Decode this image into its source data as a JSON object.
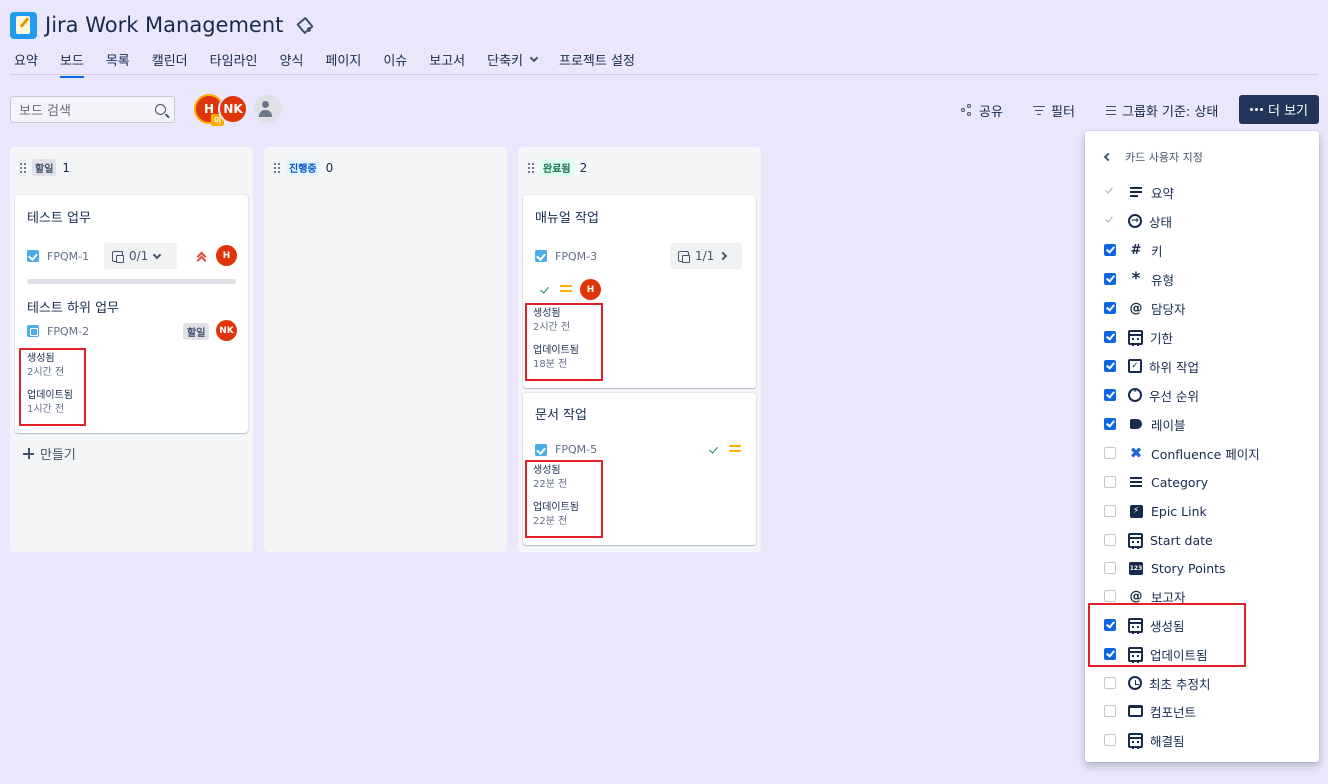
{
  "header": {
    "title": "Jira Work Management"
  },
  "tabs": [
    {
      "label": "요약"
    },
    {
      "label": "보드"
    },
    {
      "label": "목록"
    },
    {
      "label": "캘린더"
    },
    {
      "label": "타임라인"
    },
    {
      "label": "양식"
    },
    {
      "label": "페이지"
    },
    {
      "label": "이슈"
    },
    {
      "label": "보고서"
    },
    {
      "label": "단축키"
    },
    {
      "label": "프로젝트 설정"
    }
  ],
  "toolbar": {
    "search_placeholder": "보드 검색",
    "avatar_h": "H",
    "avatar_h_badge": "이",
    "avatar_nk": "NK",
    "share": "공유",
    "filter": "필터",
    "group_by": "그룹화 기준: 상태",
    "more": "더 보기"
  },
  "columns": [
    {
      "status": "할일",
      "count": "1"
    },
    {
      "status": "진행중",
      "count": "0"
    },
    {
      "status": "완료됨",
      "count": "2"
    }
  ],
  "cards": {
    "c1": {
      "title": "테스트 업무",
      "key": "FPQM-1",
      "child_progress": "0/1",
      "assignee": "H",
      "subtask_title": "테스트 하위 업무",
      "subtask_key": "FPQM-2",
      "subtask_status": "할일",
      "subtask_assignee": "NK",
      "created_label": "생성됨",
      "created_value": "2시간 전",
      "updated_label": "업데이트됨",
      "updated_value": "1시간 전"
    },
    "c3": {
      "title": "매뉴얼 작업",
      "key": "FPQM-3",
      "child_progress": "1/1",
      "assignee": "H",
      "created_label": "생성됨",
      "created_value": "2시간 전",
      "updated_label": "업데이트됨",
      "updated_value": "18분 전"
    },
    "c5": {
      "title": "문서 작업",
      "key": "FPQM-5",
      "created_label": "생성됨",
      "created_value": "22분 전",
      "updated_label": "업데이트됨",
      "updated_value": "22분 전"
    },
    "create_label": "만들기"
  },
  "panel": {
    "title": "카드 사용자 지정",
    "options": [
      {
        "label": "요약",
        "state": "disabled",
        "icon": "summary-lines-icon"
      },
      {
        "label": "상태",
        "state": "disabled",
        "icon": "status-arrow-icon"
      },
      {
        "label": "키",
        "state": "checked",
        "icon": "hash-icon"
      },
      {
        "label": "유형",
        "state": "checked",
        "icon": "asterisk-icon"
      },
      {
        "label": "담당자",
        "state": "checked",
        "icon": "at-icon"
      },
      {
        "label": "기한",
        "state": "checked",
        "icon": "calendar-icon"
      },
      {
        "label": "하위 작업",
        "state": "checked",
        "icon": "subtask-icon"
      },
      {
        "label": "우선 순위",
        "state": "checked",
        "icon": "priority-icon"
      },
      {
        "label": "레이블",
        "state": "checked",
        "icon": "tag-icon"
      },
      {
        "label": "Confluence 페이지",
        "state": "unchecked",
        "icon": "confluence-icon"
      },
      {
        "label": "Category",
        "state": "unchecked",
        "icon": "list-icon"
      },
      {
        "label": "Epic Link",
        "state": "unchecked",
        "icon": "epic-bolt-icon"
      },
      {
        "label": "Start date",
        "state": "unchecked",
        "icon": "calendar-icon"
      },
      {
        "label": "Story Points",
        "state": "unchecked",
        "icon": "story-points-icon"
      },
      {
        "label": "보고자",
        "state": "unchecked",
        "icon": "at-icon"
      },
      {
        "label": "생성됨",
        "state": "checked",
        "icon": "calendar-icon"
      },
      {
        "label": "업데이트됨",
        "state": "checked",
        "icon": "calendar-icon"
      },
      {
        "label": "최초 추정치",
        "state": "unchecked",
        "icon": "clock-icon"
      },
      {
        "label": "컴포넌트",
        "state": "unchecked",
        "icon": "component-icon"
      },
      {
        "label": "해결됨",
        "state": "unchecked",
        "icon": "calendar-icon"
      }
    ]
  },
  "colors": {
    "accent": "#0c66e4",
    "highlight_box": "#e2222a",
    "more_button": "#22345a",
    "background": "#eae6fb"
  }
}
